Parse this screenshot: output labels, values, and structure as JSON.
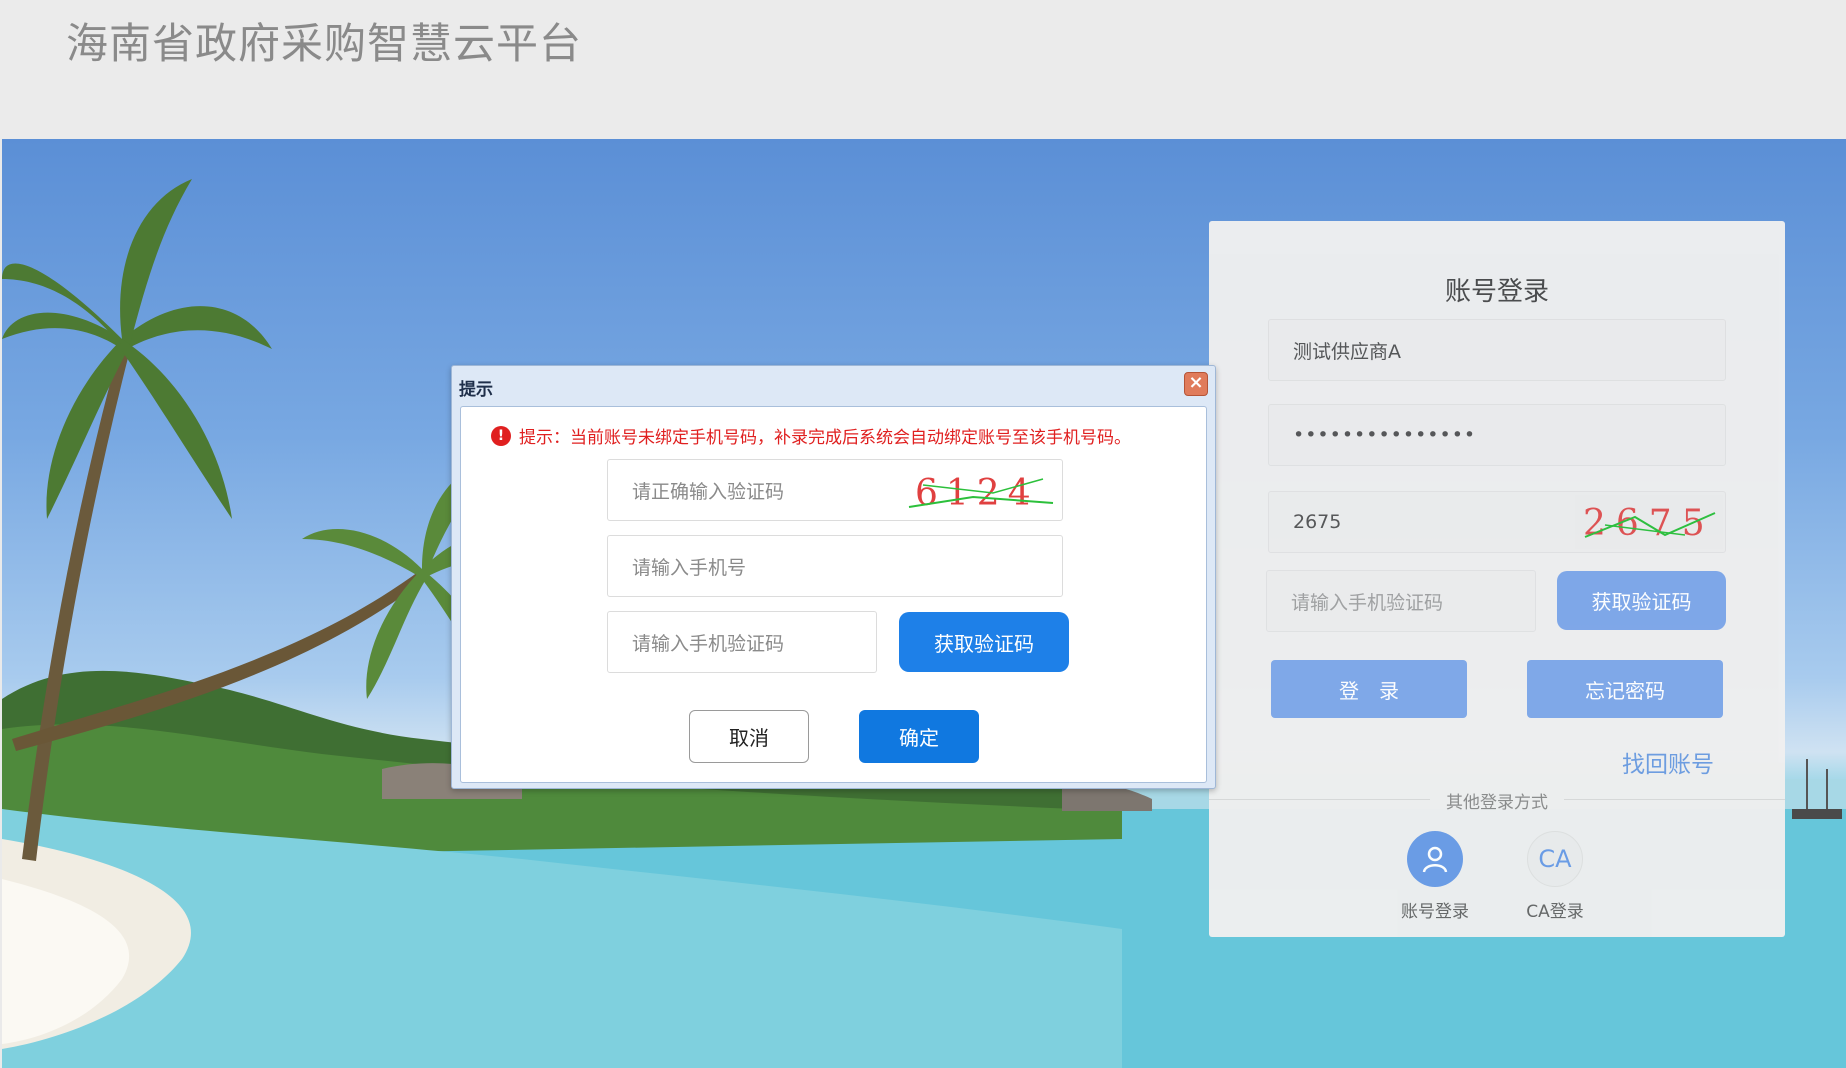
{
  "header": {
    "site_title": "海南省政府采购智慧云平台"
  },
  "login": {
    "title": "账号登录",
    "username_value": "测试供应商A",
    "password_value": "•••••••••••••••",
    "captcha_value": "2675",
    "captcha_image_text": "2675",
    "sms_placeholder": "请输入手机验证码",
    "get_code_label": "获取验证码",
    "login_label": "登　录",
    "forgot_label": "忘记密码",
    "find_account_label": "找回账号",
    "other_methods_label": "其他登录方式",
    "methods": [
      {
        "label": "账号登录",
        "icon": "user-icon"
      },
      {
        "label": "CA登录",
        "icon": "ca-icon",
        "icon_text": "CA"
      }
    ]
  },
  "modal": {
    "title": "提示",
    "notice": "提示：当前账号未绑定手机号码，补录完成后系统会自动绑定账号至该手机号码。",
    "captcha_placeholder": "请正确输入验证码",
    "captcha_image_text": "6124",
    "phone_placeholder": "请输入手机号",
    "sms_placeholder": "请输入手机验证码",
    "get_code_label": "获取验证码",
    "cancel_label": "取消",
    "confirm_label": "确定"
  },
  "colors": {
    "accent_blue": "#1e80e8",
    "soft_blue": "#7ea7e8",
    "link_blue": "#6b9be0",
    "notice_red": "#e02020"
  }
}
